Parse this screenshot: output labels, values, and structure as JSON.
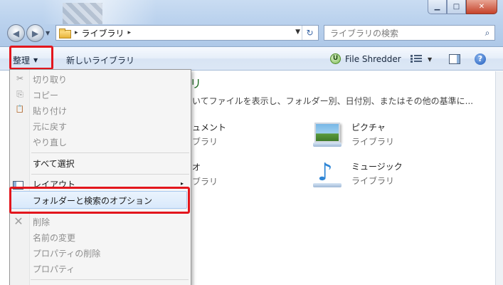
{
  "window": {
    "minimize_glyph": "▁",
    "maximize_glyph": "□",
    "close_glyph": "✕"
  },
  "nav": {
    "back_glyph": "◀",
    "forward_glyph": "▶",
    "dropdown_glyph": "▼"
  },
  "address": {
    "separator": "▸",
    "path": "ライブラリ",
    "trailing_separator": "▸",
    "dropdown_glyph": "▼",
    "refresh_glyph": "↻"
  },
  "search": {
    "placeholder": "ライブラリの検索",
    "icon_glyph": "⌕"
  },
  "toolbar": {
    "organize_label": "整理",
    "organize_arrow": "▼",
    "new_library_label": "新しいライブラリ",
    "file_shredder_label": "File Shredder",
    "file_shredder_icon": "U",
    "views_dropdown_glyph": "▼",
    "help_glyph": "?"
  },
  "main": {
    "title_fragment": "リ",
    "description": "いてファイルを表示し、フォルダー別、日付別、またはその他の基準に...",
    "partial_items": [
      {
        "name": "ュメント",
        "sub": "ブラリ"
      },
      {
        "name": "オ",
        "sub": "ブラリ"
      }
    ],
    "libraries": [
      {
        "name": "ピクチャ",
        "sub": "ライブラリ",
        "icon": "pictures-icon"
      },
      {
        "name": "ミュージック",
        "sub": "ライブラリ",
        "icon": "music-icon"
      }
    ]
  },
  "menu": {
    "items": [
      {
        "label": "切り取り",
        "enabled": false,
        "icon": "✂"
      },
      {
        "label": "コピー",
        "enabled": false,
        "icon": "⎘"
      },
      {
        "label": "貼り付け",
        "enabled": false,
        "icon": "📋"
      },
      {
        "label": "元に戻す",
        "enabled": false
      },
      {
        "label": "やり直し",
        "enabled": false
      },
      {
        "label": "すべて選択",
        "enabled": true
      },
      {
        "label": "レイアウト",
        "enabled": true,
        "submenu": "▸"
      },
      {
        "label": "フォルダーと検索のオプション",
        "enabled": true
      },
      {
        "label": "削除",
        "enabled": false,
        "icon": "✕"
      },
      {
        "label": "名前の変更",
        "enabled": false
      },
      {
        "label": "プロパティの削除",
        "enabled": false
      },
      {
        "label": "プロパティ",
        "enabled": false
      }
    ]
  },
  "colors": {
    "highlight_box": "#e3161d",
    "library_title": "#1e6b22",
    "disabled_text": "#8d8d8d"
  }
}
